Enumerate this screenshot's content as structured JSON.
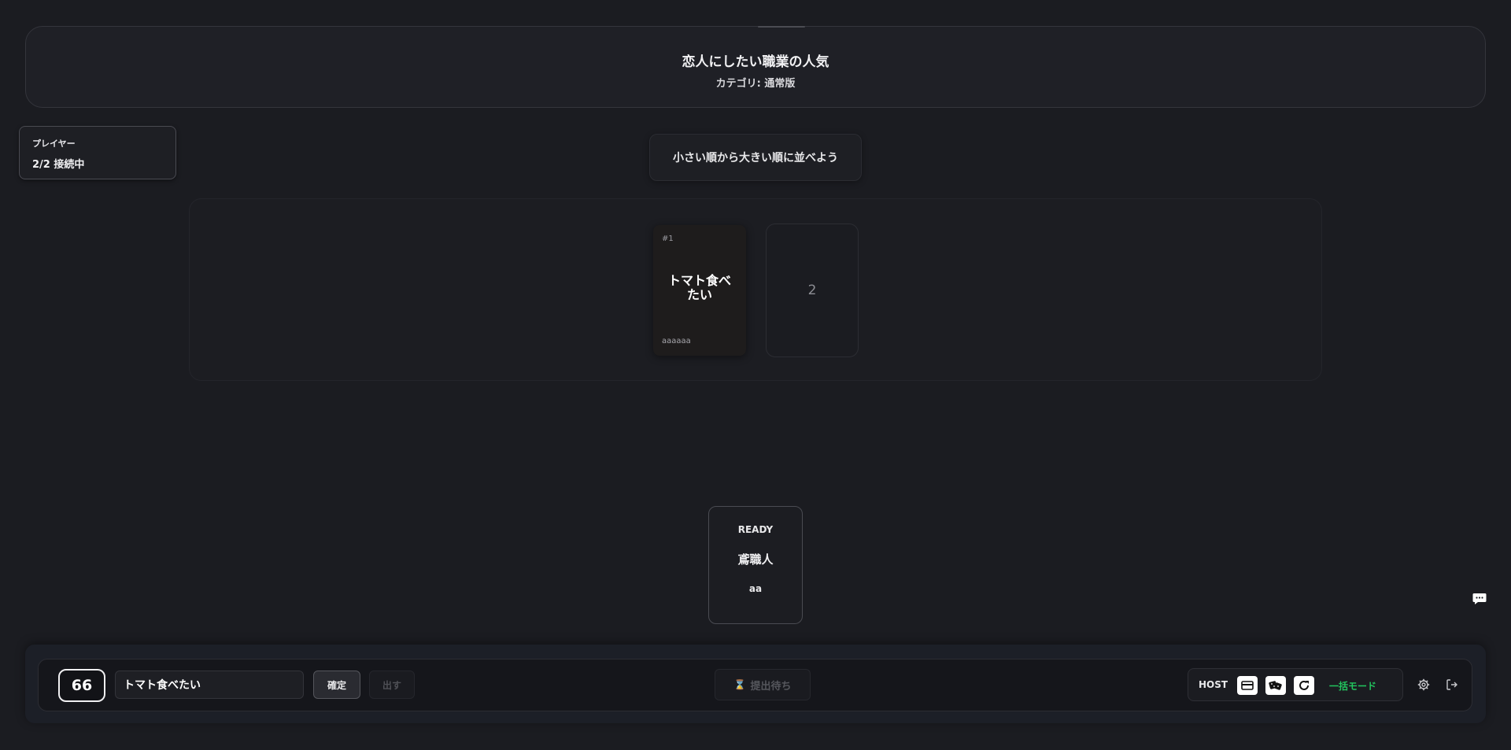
{
  "topic": {
    "title": "恋人にしたい職業の人気",
    "category": "カテゴリ: 通常版"
  },
  "players": {
    "label": "プレイヤー",
    "count": "2/2 接続中"
  },
  "instruction": "小さい順から大きい順に並べよう",
  "board": {
    "played_card": {
      "number": "#1",
      "text": "トマト食べたい",
      "author": "aaaaaa"
    },
    "empty_slot": "2"
  },
  "ready_card": {
    "status": "READY",
    "topic": "鳶職人",
    "name": "aa"
  },
  "controls": {
    "number": "66",
    "answer_value": "トマト食べたい",
    "confirm_label": "確定",
    "play_label": "出す",
    "waiting_label": "提出待ち",
    "host_label": "HOST",
    "bulk_mode_label": "一括モード"
  },
  "icons": {
    "chat": "chat-bubble-icon",
    "host_buttons": [
      "card-icon",
      "dice-icon",
      "restart-icon"
    ],
    "settings": "gear-icon",
    "exit": "logout-icon",
    "hourglass": "hourglass-icon"
  },
  "colors": {
    "background": "#1b1c21",
    "accent_green": "#22c55e"
  }
}
